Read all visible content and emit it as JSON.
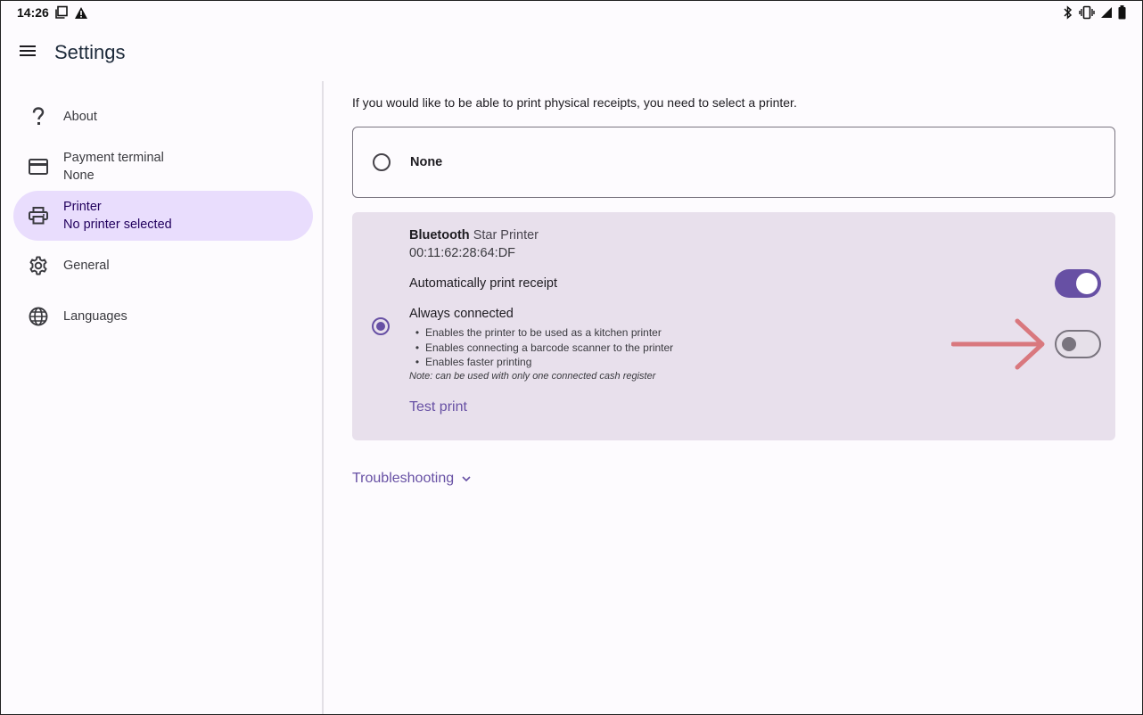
{
  "status_bar": {
    "time": "14:26",
    "left_icons": [
      "copy-icon",
      "warning-icon"
    ],
    "right_icons": [
      "bluetooth-icon",
      "vibrate-icon",
      "signal-icon",
      "battery-icon"
    ]
  },
  "app_bar": {
    "title": "Settings",
    "menu_icon": "menu-icon"
  },
  "sidebar": {
    "items": [
      {
        "id": "about",
        "icon": "help-icon",
        "label": "About",
        "sublabel": ""
      },
      {
        "id": "payment-terminal",
        "icon": "card-icon",
        "label": "Payment terminal",
        "sublabel": "None"
      },
      {
        "id": "printer",
        "icon": "printer-icon",
        "label": "Printer",
        "sublabel": "No printer selected",
        "active": true
      },
      {
        "id": "general",
        "icon": "gear-icon",
        "label": "General",
        "sublabel": ""
      },
      {
        "id": "languages",
        "icon": "globe-icon",
        "label": "Languages",
        "sublabel": ""
      }
    ]
  },
  "main": {
    "intro": "If you would like to be able to print physical receipts, you need to select a printer.",
    "option_none": {
      "label": "None",
      "selected": false
    },
    "printer": {
      "selected": true,
      "connection": "Bluetooth",
      "model": "Star Printer",
      "mac": "00:11:62:28:64:DF",
      "auto_print_label": "Automatically print receipt",
      "auto_print_on": true,
      "always_connected_label": "Always connected",
      "always_connected_on": false,
      "bullets": [
        "Enables the printer to be used as a kitchen printer",
        "Enables connecting a barcode scanner to the printer",
        "Enables faster printing"
      ],
      "note": "Note: can be used with only one connected cash register",
      "test_print_label": "Test print"
    },
    "troubleshooting_label": "Troubleshooting"
  },
  "colors": {
    "accent": "#6750a4",
    "active_nav_bg": "#e9ddfd",
    "card_bg": "#e8e0ec",
    "annotation_arrow": "#d9787e"
  }
}
